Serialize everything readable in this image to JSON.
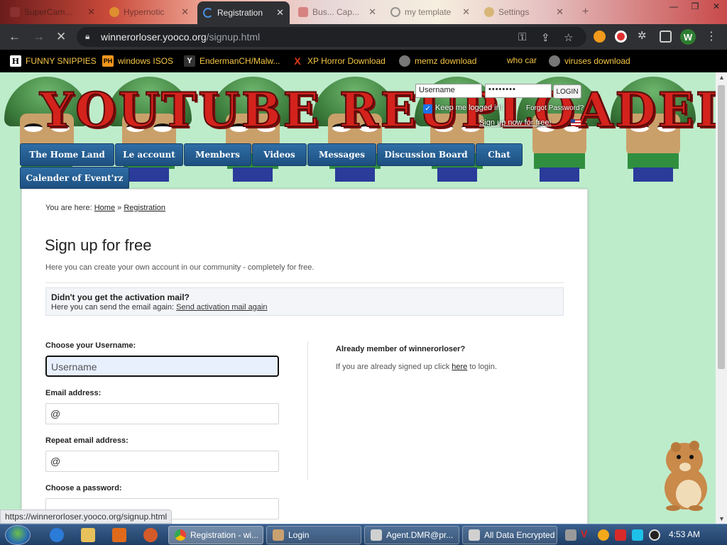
{
  "tabs": [
    {
      "label": "SuperCam..."
    },
    {
      "label": "Hypernotic"
    },
    {
      "label": "Registration"
    },
    {
      "label": "Bus... Cap..."
    },
    {
      "label": "my template"
    },
    {
      "label": "Settings"
    }
  ],
  "address": {
    "host": "winnerorloser.yooco.org",
    "path": "/signup.html"
  },
  "bookmarks": [
    {
      "label": "FUNNY SNIPPIES",
      "icon": "H"
    },
    {
      "label": "windows ISOS",
      "icon": "PH"
    },
    {
      "label": "EndermanCH/Malw...",
      "icon": "Y"
    },
    {
      "label": "XP Horror Download",
      "icon": "X"
    },
    {
      "label": "memz download",
      "icon": ""
    },
    {
      "label": "who car",
      "icon": ""
    },
    {
      "label": "viruses download",
      "icon": ""
    }
  ],
  "banner": {
    "title": "YOUTUBE REUPLOADED"
  },
  "login": {
    "username_placeholder": "Username",
    "password_value": "••••••••",
    "login_button": "LOGIN",
    "keep_logged_in": "Keep me logged in!",
    "forgot": "Forgot Password?",
    "signup_link": "Sign up now for free!"
  },
  "nav": {
    "items": [
      {
        "label": "The Home Land"
      },
      {
        "label": "Le account"
      },
      {
        "label": "Members"
      },
      {
        "label": "Videos"
      },
      {
        "label": "Messages"
      },
      {
        "label": "Discussion Board"
      },
      {
        "label": "Chat"
      },
      {
        "label": "Calender of Event'rz"
      }
    ]
  },
  "breadcrumb": {
    "prefix": "You are here:",
    "home": "Home",
    "sep": "»",
    "current": "Registration"
  },
  "page": {
    "title": "Sign up for free",
    "intro": "Here you can create your own account in our community - completely for free."
  },
  "notice": {
    "heading": "Didn't you get the activation mail?",
    "text": "Here you can send the email again:",
    "link": "Send activation mail again"
  },
  "form": {
    "username_label": "Choose your Username:",
    "username_placeholder": "Username",
    "email_label": "Email address:",
    "email_value": "@",
    "repeat_email_label": "Repeat email address:",
    "repeat_email_value": "@",
    "password_label": "Choose a password:"
  },
  "member": {
    "heading": "Already member of winnerorloser?",
    "text_before": "If you are already signed up click",
    "link": "here",
    "text_after": "to login."
  },
  "status_url": "https://winnerorloser.yooco.org/signup.html",
  "taskbar": {
    "tasks": [
      {
        "label": "Registration - wi..."
      },
      {
        "label": "Login"
      },
      {
        "label": "Agent.DMR@pr..."
      },
      {
        "label": "All Data Encrypted"
      }
    ],
    "clock": "4:53 AM"
  },
  "colors": {
    "nav_button": "#1d4f80",
    "page_bg": "#bdeccb",
    "title_red": "#d4221c",
    "bookmark_text": "#f4c542"
  }
}
